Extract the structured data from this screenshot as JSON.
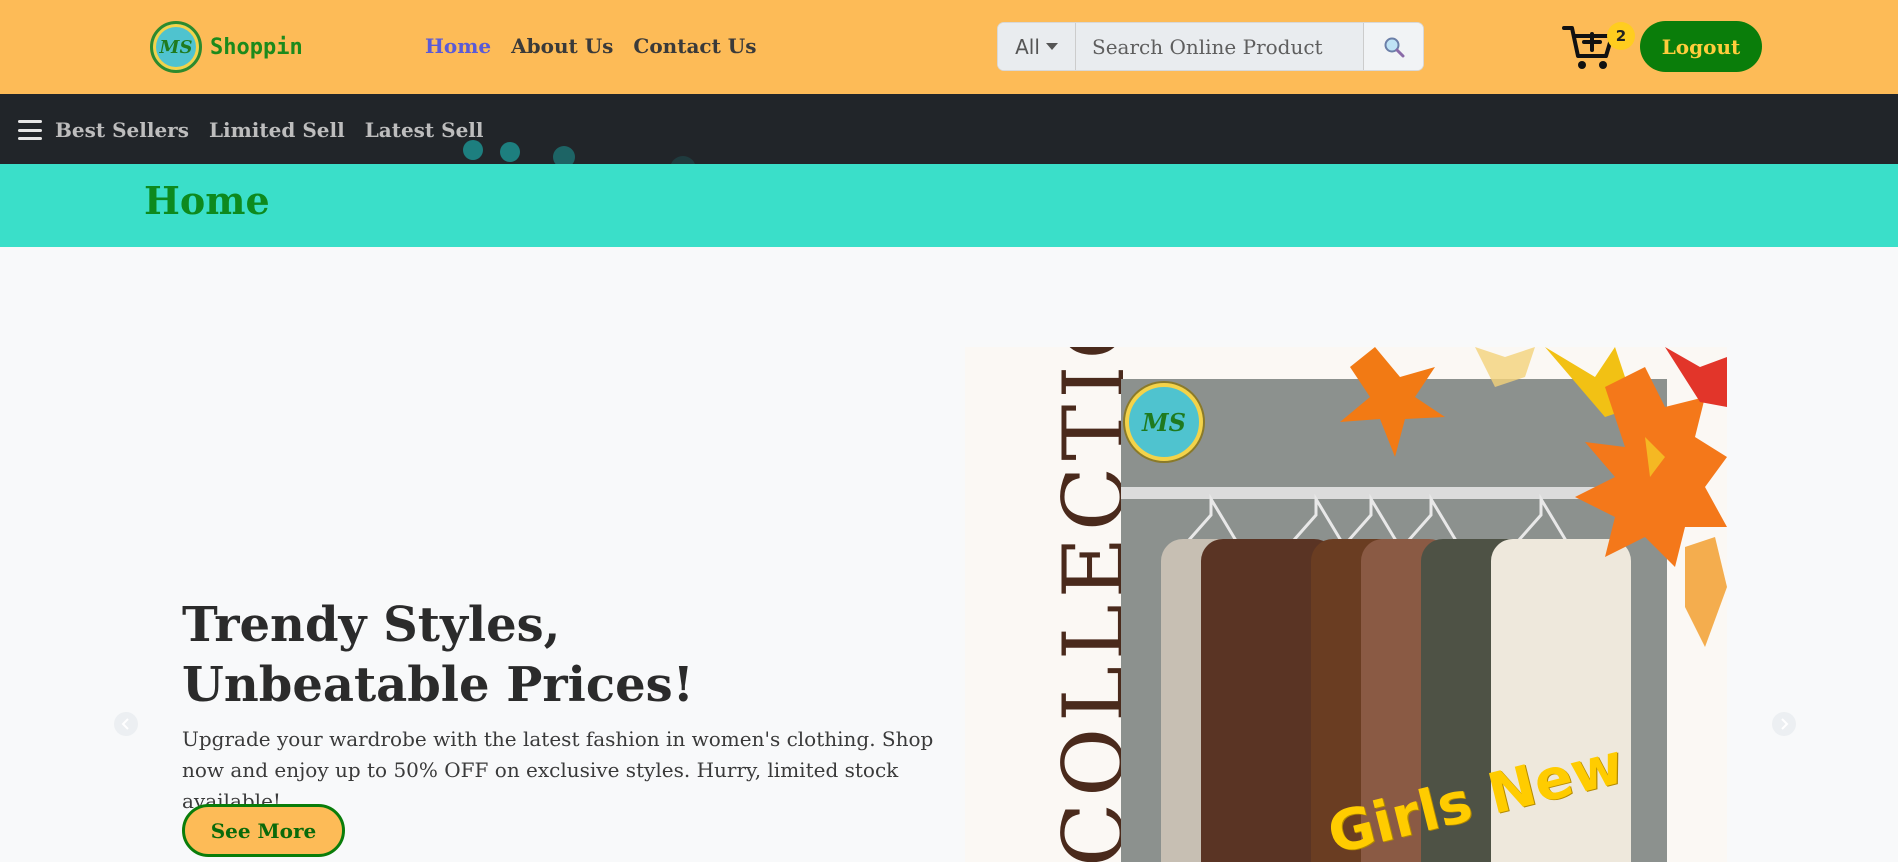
{
  "header": {
    "brand_initials": "MS",
    "brand_name": "Shopping",
    "nav": [
      {
        "label": "Home",
        "active": true
      },
      {
        "label": "About Us",
        "active": false
      },
      {
        "label": "Contact Us",
        "active": false
      }
    ],
    "search": {
      "category": "All",
      "placeholder": "Search Online Product",
      "button_icon": "search-icon"
    },
    "cart_count": "2",
    "logout_label": "Logout"
  },
  "subnav": {
    "menu_icon": "hamburger-icon",
    "links": [
      "Best Sellers",
      "Limited Sell",
      "Latest Sell"
    ]
  },
  "page": {
    "title": "Home"
  },
  "hero": {
    "title": "Trendy Styles, Unbeatable Prices!",
    "text": "Upgrade your wardrobe with the latest fashion in women's clothing. Shop now and enjoy up to 50% OFF on exclusive styles. Hurry, limited stock available!",
    "button_label": "See More",
    "banner": {
      "side_text": "COLLECTION",
      "promo_text": "Girls New",
      "logo_initials": "MS"
    }
  },
  "colors": {
    "topbar": "#fdbb57",
    "subbar": "#212529",
    "page_head": "#3adfc9",
    "accent_green": "#0a7d0a",
    "active_link": "#5b5bd6"
  }
}
